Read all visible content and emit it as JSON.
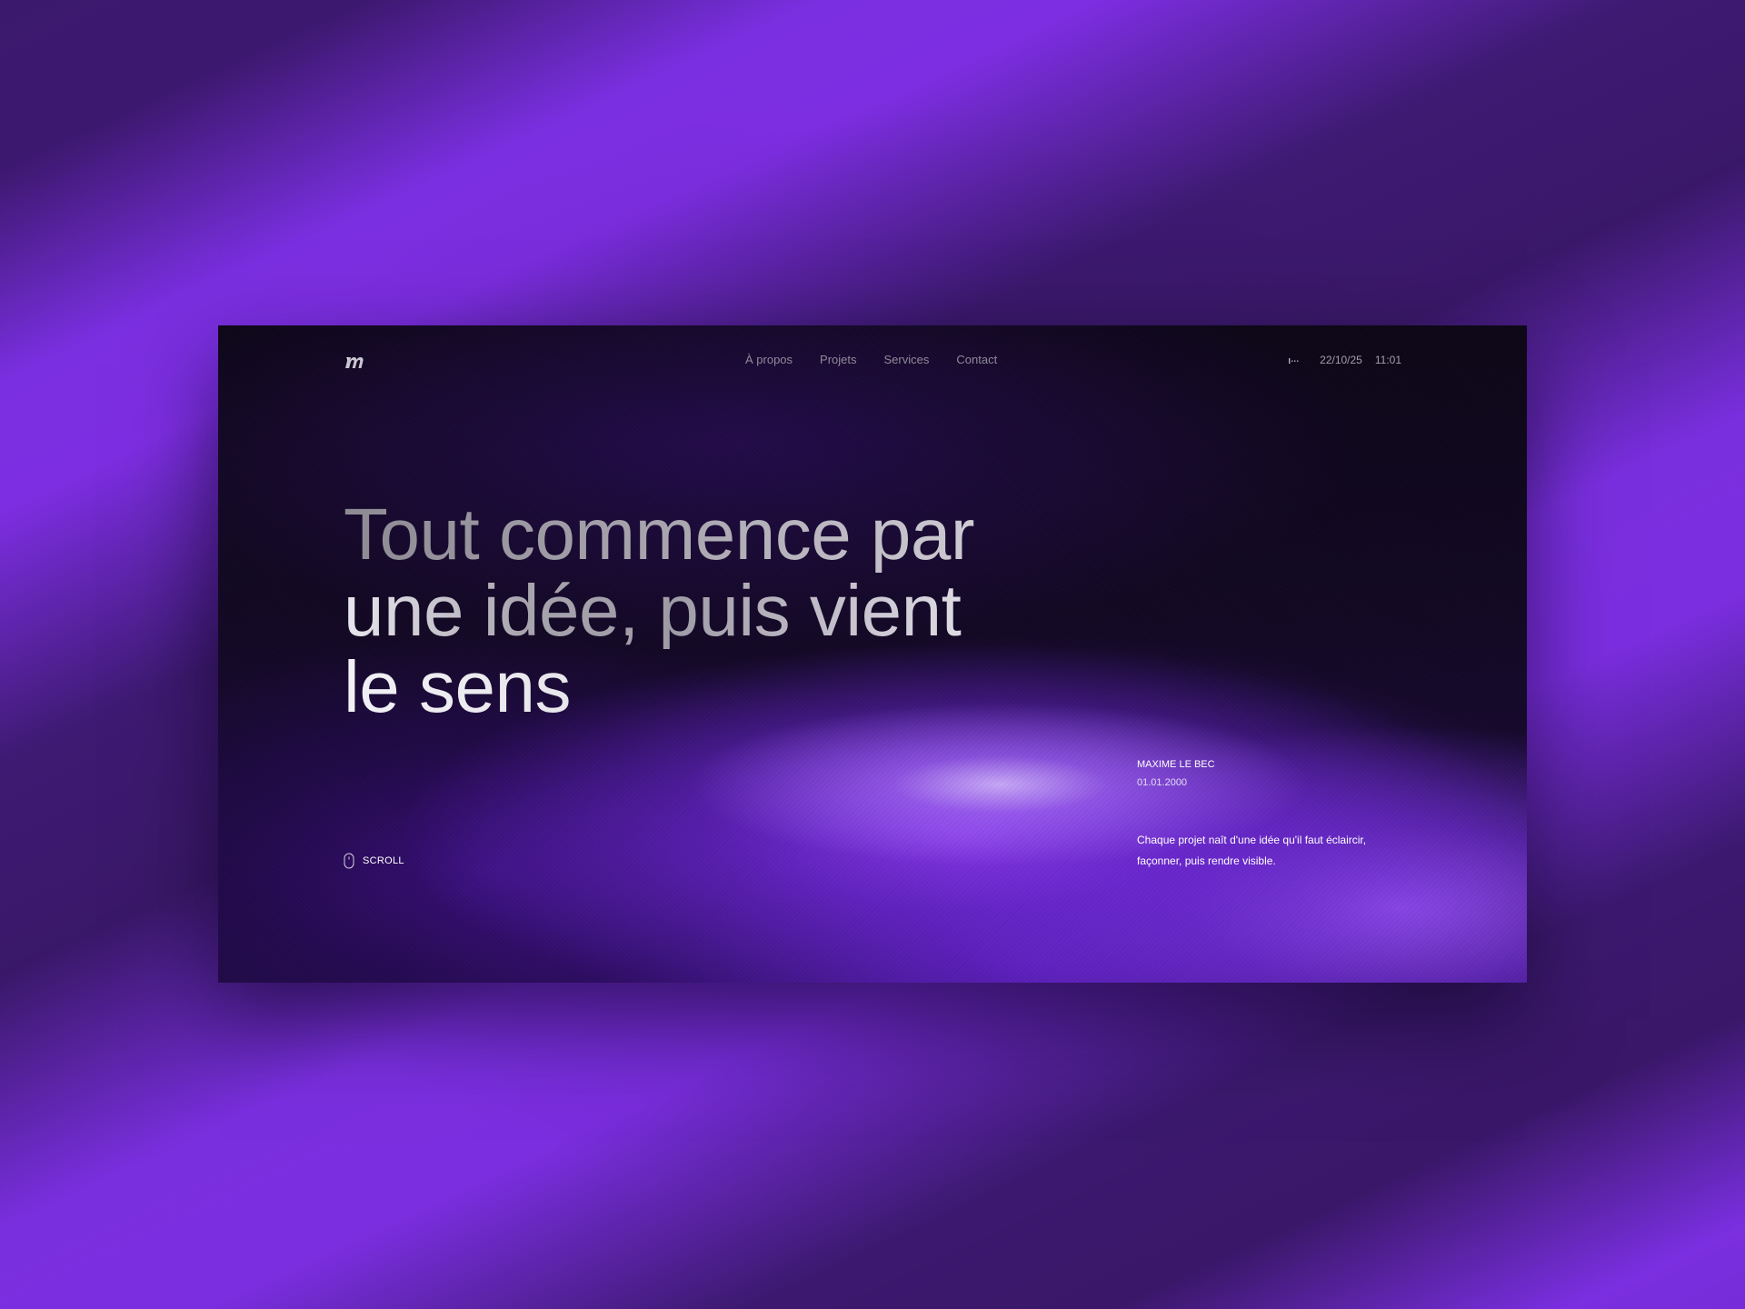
{
  "brand": {
    "logo_icon": "m-monogram-logo"
  },
  "nav": {
    "items": [
      {
        "label": "À propos"
      },
      {
        "label": "Projets"
      },
      {
        "label": "Services"
      },
      {
        "label": "Contact"
      }
    ]
  },
  "status": {
    "signal_icon": "signal-icon",
    "date": "22/10/25",
    "time": "11:01"
  },
  "hero": {
    "line1": "Tout commence par",
    "line2": "une idée, puis vient",
    "line3": "le sens"
  },
  "scroll": {
    "icon": "mouse-icon",
    "label": "SCROLL"
  },
  "author": {
    "name": "MAXIME LE BEC",
    "date": "01.01.2000"
  },
  "description": {
    "line1": "Chaque projet naît d'une idée qu'il faut éclaircir,",
    "line2": "façonner, puis rendre visible."
  },
  "colors": {
    "backdrop_stripe": "#7a2fe0",
    "backdrop_dark": "#3c1870",
    "screen_bg": "#0a0512",
    "accent_glow": "#8737eb"
  }
}
